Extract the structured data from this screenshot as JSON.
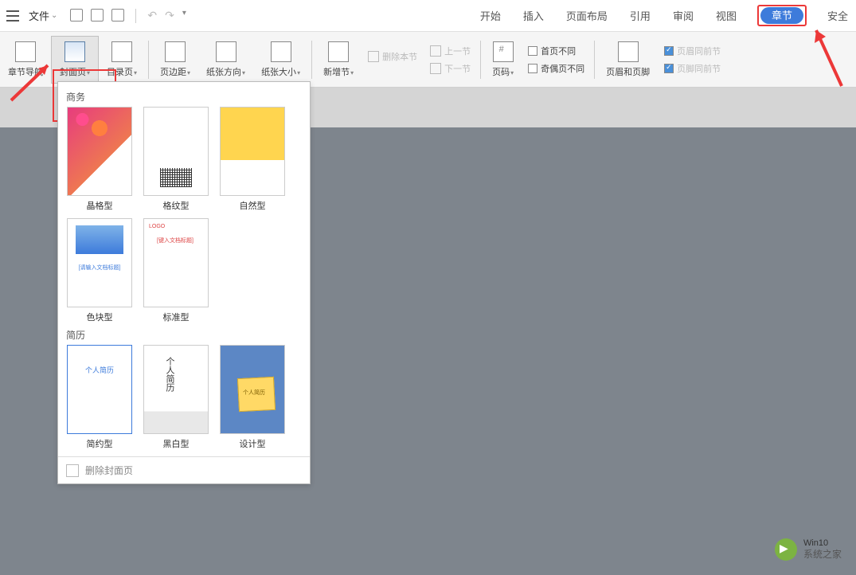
{
  "menubar": {
    "file_label": "文件",
    "quick_access": {
      "save": "保存",
      "print": "打印",
      "preview": "预览",
      "undo": "撤销",
      "redo": "重做",
      "more": "自定义"
    }
  },
  "tabs": {
    "start": "开始",
    "insert": "插入",
    "page_layout": "页面布局",
    "references": "引用",
    "review": "审阅",
    "view": "视图",
    "section": "章节",
    "security": "安全"
  },
  "ribbon": {
    "section_nav": "章节导航",
    "cover_page": "封面页",
    "toc_page": "目录页",
    "margins": "页边距",
    "orientation": "纸张方向",
    "paper_size": "纸张大小",
    "add_section": "新增节",
    "delete_section": "删除本节",
    "prev_section": "上一节",
    "next_section": "下一节",
    "page_numbers": "页码",
    "first_page_diff": "首页不同",
    "odd_even_diff": "奇偶页不同",
    "header_footer": "页眉和页脚",
    "header_link_prev": "页眉同前节",
    "footer_link_prev": "页脚同前节"
  },
  "cover_panel": {
    "section1": "商务",
    "section2": "简历",
    "templates": {
      "business": [
        {
          "name": "晶格型"
        },
        {
          "name": "格纹型"
        },
        {
          "name": "自然型"
        },
        {
          "name": "色块型",
          "caption": "[请输入文档标题]"
        },
        {
          "name": "标准型",
          "caption": "[键入文档标题]"
        }
      ],
      "resume": [
        {
          "name": "简约型",
          "caption": "个人简历"
        },
        {
          "name": "黑白型",
          "caption": "个人简历"
        },
        {
          "name": "设计型",
          "caption": "个人简历"
        }
      ]
    },
    "delete_cover": "删除封面页"
  },
  "watermark": {
    "line1": "Win10",
    "line2": "系统之家"
  }
}
